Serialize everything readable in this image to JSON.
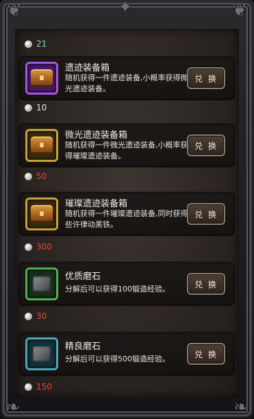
{
  "currency": {
    "icon": "silver-coin-icon",
    "balance": "21",
    "balance_color": "#7fd3c2"
  },
  "items": [
    {
      "icon": "treasure-chest-icon",
      "icon_frame": "purple",
      "title": "遗迹装备箱",
      "description": "随机获得一件遗迹装备,小概率获得微光遗迹装备。",
      "button": "兑 换",
      "cost": "10",
      "cost_color": "#e6e6e6"
    },
    {
      "icon": "treasure-chest-icon",
      "icon_frame": "gold",
      "title": "微光遗迹装备箱",
      "description": "随机获得一件微光遗迹装备,小概率获得璀璨遗迹装备。",
      "button": "兑 换",
      "cost": "50",
      "cost_color": "#e04a3a"
    },
    {
      "icon": "treasure-chest-icon",
      "icon_frame": "gold",
      "title": "璀璨遗迹装备箱",
      "description": "随机获得一件璀璨遗迹装备,同时获得些许律动黑铁。",
      "button": "兑 换",
      "cost": "300",
      "cost_color": "#e04a3a"
    },
    {
      "icon": "whetstone-icon",
      "icon_frame": "green",
      "title": "优质磨石",
      "description": "分解后可以获得100锻造经验。",
      "button": "兑 换",
      "cost": "30",
      "cost_color": "#e04a3a"
    },
    {
      "icon": "whetstone-icon",
      "icon_frame": "teal",
      "title": "精良磨石",
      "description": "分解后可以获得500锻造经验。",
      "button": "兑 换",
      "cost": "150",
      "cost_color": "#e04a3a"
    }
  ]
}
